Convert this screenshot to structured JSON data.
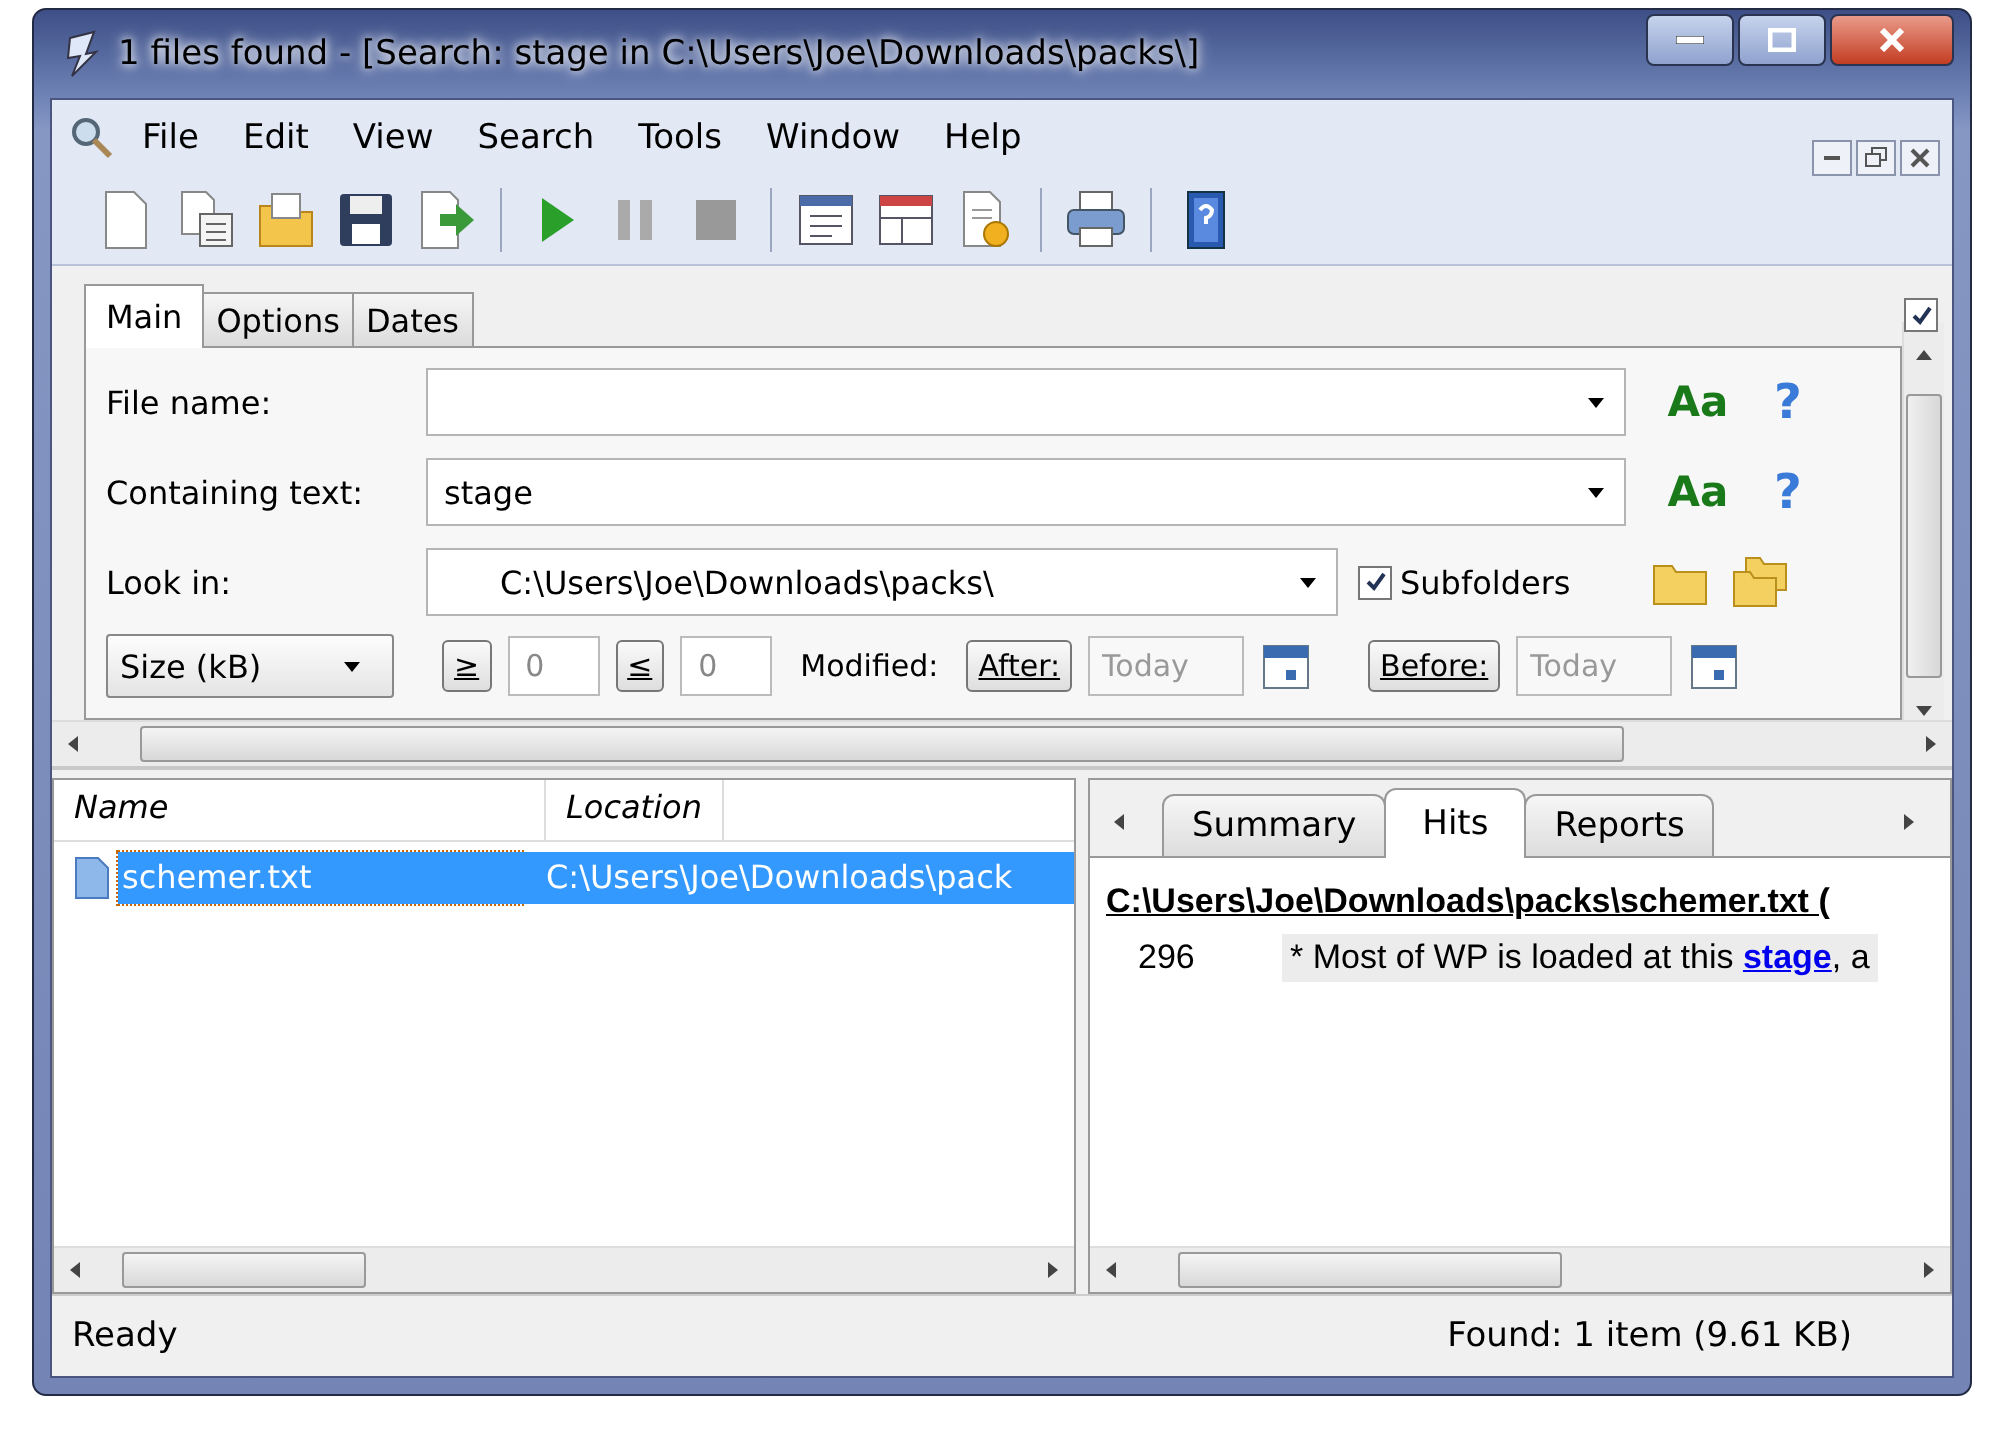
{
  "window": {
    "title": "1 files found - [Search: stage in C:\\Users\\Joe\\Downloads\\packs\\]"
  },
  "menu": [
    {
      "label": "File"
    },
    {
      "label": "Edit"
    },
    {
      "label": "View"
    },
    {
      "label": "Search"
    },
    {
      "label": "Tools"
    },
    {
      "label": "Window"
    },
    {
      "label": "Help"
    }
  ],
  "search_tabs": [
    {
      "label": "Main",
      "selected": true
    },
    {
      "label": "Options",
      "selected": false
    },
    {
      "label": "Dates",
      "selected": false
    }
  ],
  "side_checkbox": {
    "checked": true
  },
  "form": {
    "file_name": {
      "label": "File name:",
      "case_button": "Aa",
      "help": "?"
    },
    "containing_text": {
      "label": "Containing text:",
      "value": "stage",
      "case_button": "Aa",
      "help": "?"
    },
    "look_in": {
      "label": "Look in:",
      "value": "C:\\Users\\Joe\\Downloads\\packs\\"
    },
    "subfolders": {
      "label": "Subfolders",
      "checked": true
    },
    "size": {
      "value": "Size (kB)",
      "min_button": "≥",
      "min": "0",
      "max_button": "≤",
      "max": "0"
    },
    "modified": {
      "label": "Modified:",
      "after": {
        "button": "After:",
        "value": "Today",
        "disabled": true
      },
      "before": {
        "button": "Before:",
        "value": "Today",
        "disabled": true
      }
    }
  },
  "results": {
    "columns": [
      "Name",
      "Location"
    ],
    "rows": [
      {
        "name": "schemer.txt",
        "location": "C:\\Users\\Joe\\Downloads\\pack",
        "selected": true
      }
    ]
  },
  "preview": {
    "tabs": [
      {
        "label": "Summary",
        "selected": false
      },
      {
        "label": "Hits",
        "selected": true
      },
      {
        "label": "Reports",
        "selected": false
      }
    ],
    "path": "C:\\Users\\Joe\\Downloads\\packs\\schemer.txt   (",
    "hits": [
      {
        "line": "296",
        "text": "* Most of WP is loaded at this ",
        "match": "stage",
        "after": ", a"
      }
    ]
  },
  "status_bar": {
    "left": "Ready",
    "right": "Found: 1 item (9.61 KB)"
  }
}
